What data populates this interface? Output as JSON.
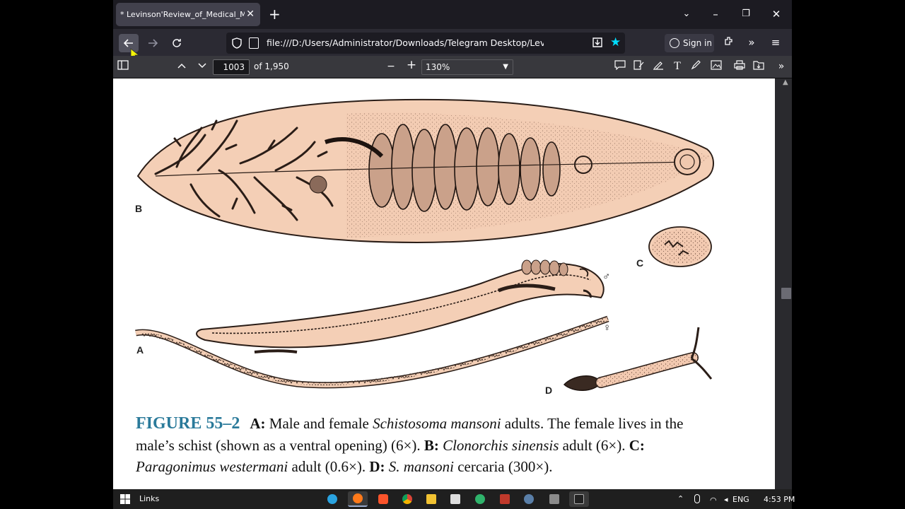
{
  "browser": {
    "tab_title": "* Levinson'Review_of_Medical_Micro",
    "tab_close": "✕",
    "new_tab": "+",
    "window_controls": {
      "list": "⌄",
      "minimize": "–",
      "restore": "❐",
      "close": "✕"
    },
    "url": "file:///D:/Users/Administrator/Downloads/Telegram Desktop/Levinson'Review_of",
    "sign_in_label": "Sign in",
    "accent_color": "#00ddff"
  },
  "pdf_toolbar": {
    "current_page": "1003",
    "page_count": "of 1,950",
    "zoom": "130%"
  },
  "figure": {
    "panel_labels": {
      "a": "A",
      "b": "B",
      "c": "C",
      "d": "D"
    },
    "male_symbol": "♂",
    "female_symbol": "♀",
    "caption": {
      "figure_label": "FIGURE 55–2",
      "a_label": "A:",
      "a_text_1": " Male and female ",
      "a_species": "Schistosoma mansoni",
      "a_text_2": " adults. The female lives in the male’s schist (shown as a ventral opening) (6×). ",
      "b_label": "B:",
      "b_species": " Clonorchis sinensis",
      "b_text": " adult (6×). ",
      "c_label": "C:",
      "c_species": " Paragonimus westermani",
      "c_text": " adult (0.6×). ",
      "d_label": "D:",
      "d_species": " S. mansoni",
      "d_text": " cercaria (300×)."
    }
  },
  "taskbar": {
    "links_label": "Links",
    "language": "ENG",
    "time": "4:53 PM"
  }
}
